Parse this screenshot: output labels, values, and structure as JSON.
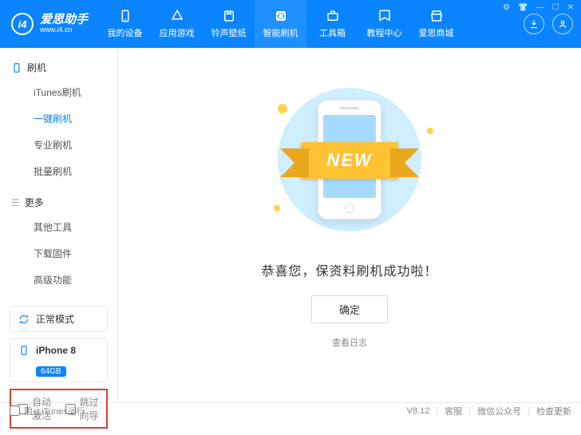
{
  "brand": {
    "logo_text": "i4",
    "name": "爱思助手",
    "url": "www.i4.cn"
  },
  "nav": [
    {
      "id": "devices",
      "label": "我的设备",
      "icon": "phone-icon"
    },
    {
      "id": "apps",
      "label": "应用游戏",
      "icon": "apps-icon"
    },
    {
      "id": "ringtone",
      "label": "铃声壁纸",
      "icon": "music-icon"
    },
    {
      "id": "flash",
      "label": "智能刷机",
      "icon": "refresh-icon",
      "active": true
    },
    {
      "id": "toolbox",
      "label": "工具箱",
      "icon": "briefcase-icon"
    },
    {
      "id": "tutorial",
      "label": "教程中心",
      "icon": "book-icon"
    },
    {
      "id": "mall",
      "label": "爱思商城",
      "icon": "shop-icon"
    }
  ],
  "sidebar": {
    "sec1_title": "刷机",
    "sec1_items": [
      {
        "label": "iTunes刷机"
      },
      {
        "label": "一键刷机",
        "active": true
      },
      {
        "label": "专业刷机"
      },
      {
        "label": "批量刷机"
      }
    ],
    "sec2_title": "更多",
    "sec2_items": [
      {
        "label": "其他工具"
      },
      {
        "label": "下载固件"
      },
      {
        "label": "高级功能"
      }
    ],
    "mode_label": "正常模式",
    "device_name": "iPhone 8",
    "device_badge": "64GB",
    "check_auto_activate": "自动激活",
    "check_skip_guide": "跳过向导"
  },
  "main": {
    "ribbon": "NEW",
    "message": "恭喜您，保资料刷机成功啦！",
    "ok_button": "确定",
    "log_link": "查看日志"
  },
  "footer": {
    "block_itunes": "阻止iTunes运行",
    "version": "V8.12",
    "support": "客服",
    "wechat": "微信公众号",
    "check_update": "检查更新"
  }
}
